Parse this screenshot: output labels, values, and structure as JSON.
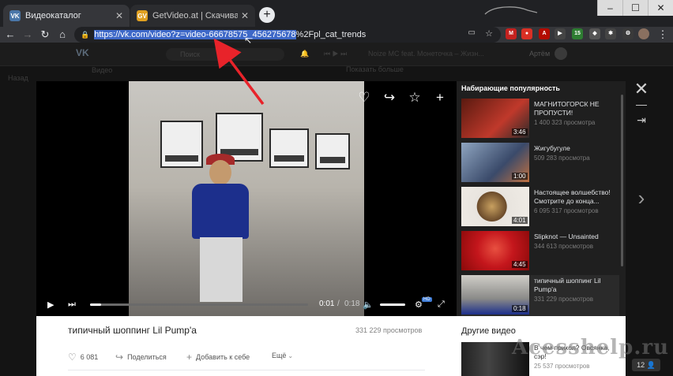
{
  "browser": {
    "tabs": [
      {
        "title": "Видеокаталог",
        "favicon": "VK",
        "active": true
      },
      {
        "title": "GetVideo.at | Скачивайте видео",
        "favicon": "GV",
        "active": false
      }
    ],
    "new_tab": "+",
    "window_controls": [
      "–",
      "☐",
      "✕"
    ],
    "url_selected": "https://vk.com/video?z=video-66678575_456275678",
    "url_rest": "%2Fpl_cat_trends",
    "extension_badge": "15"
  },
  "vk_header": {
    "logo": "VK",
    "search_placeholder": "Поиск",
    "now_playing": "Noize MC feat. Монеточка – Жизн...",
    "user_name": "Артём",
    "left_nav": "Видео",
    "back_nav": "Назад",
    "show_more": "Показать больше"
  },
  "player": {
    "time_current": "0:01",
    "time_total": "0:18",
    "progress": 0.05,
    "hd_badge": "HD",
    "volume": 1.0
  },
  "trending": {
    "heading": "Набирающие популярность",
    "items": [
      {
        "title": "МАГНИТОГОРСК НЕ ПРОПУСТИ!",
        "views": "1 400 323 просмотра",
        "duration": "3:46",
        "thumb_color": "#7a2a1a"
      },
      {
        "title": "Жигубугуле",
        "views": "509 283 просмотра",
        "duration": "1:00",
        "thumb_color": "#3a4a6a"
      },
      {
        "title": "Настоящее волшебство! Смотрите до конца...",
        "views": "6 095 317 просмотров",
        "duration": "4:01",
        "thumb_color": "#6a4a2a"
      },
      {
        "title": "Slipknot — Unsainted",
        "views": "344 613 просмотров",
        "duration": "4:45",
        "thumb_color": "#c4161c"
      },
      {
        "title": "типичный шоппинг Lil Pump'a",
        "views": "331 229 просмотров",
        "duration": "0:18",
        "thumb_color": "#8a8a88"
      }
    ]
  },
  "video_info": {
    "title": "типичный шоппинг Lil Pump'a",
    "views": "331 229 просмотров",
    "likes": "6 081",
    "share": "Поделиться",
    "add": "Добавить к себе",
    "more": "Ещё"
  },
  "other_videos": {
    "heading": "Другие видео",
    "title": "В чем прикол? Овсянка, сэр!",
    "views": "25 537 просмотров"
  },
  "watermark": "Acesshelp.ru",
  "bottom_count": "12"
}
